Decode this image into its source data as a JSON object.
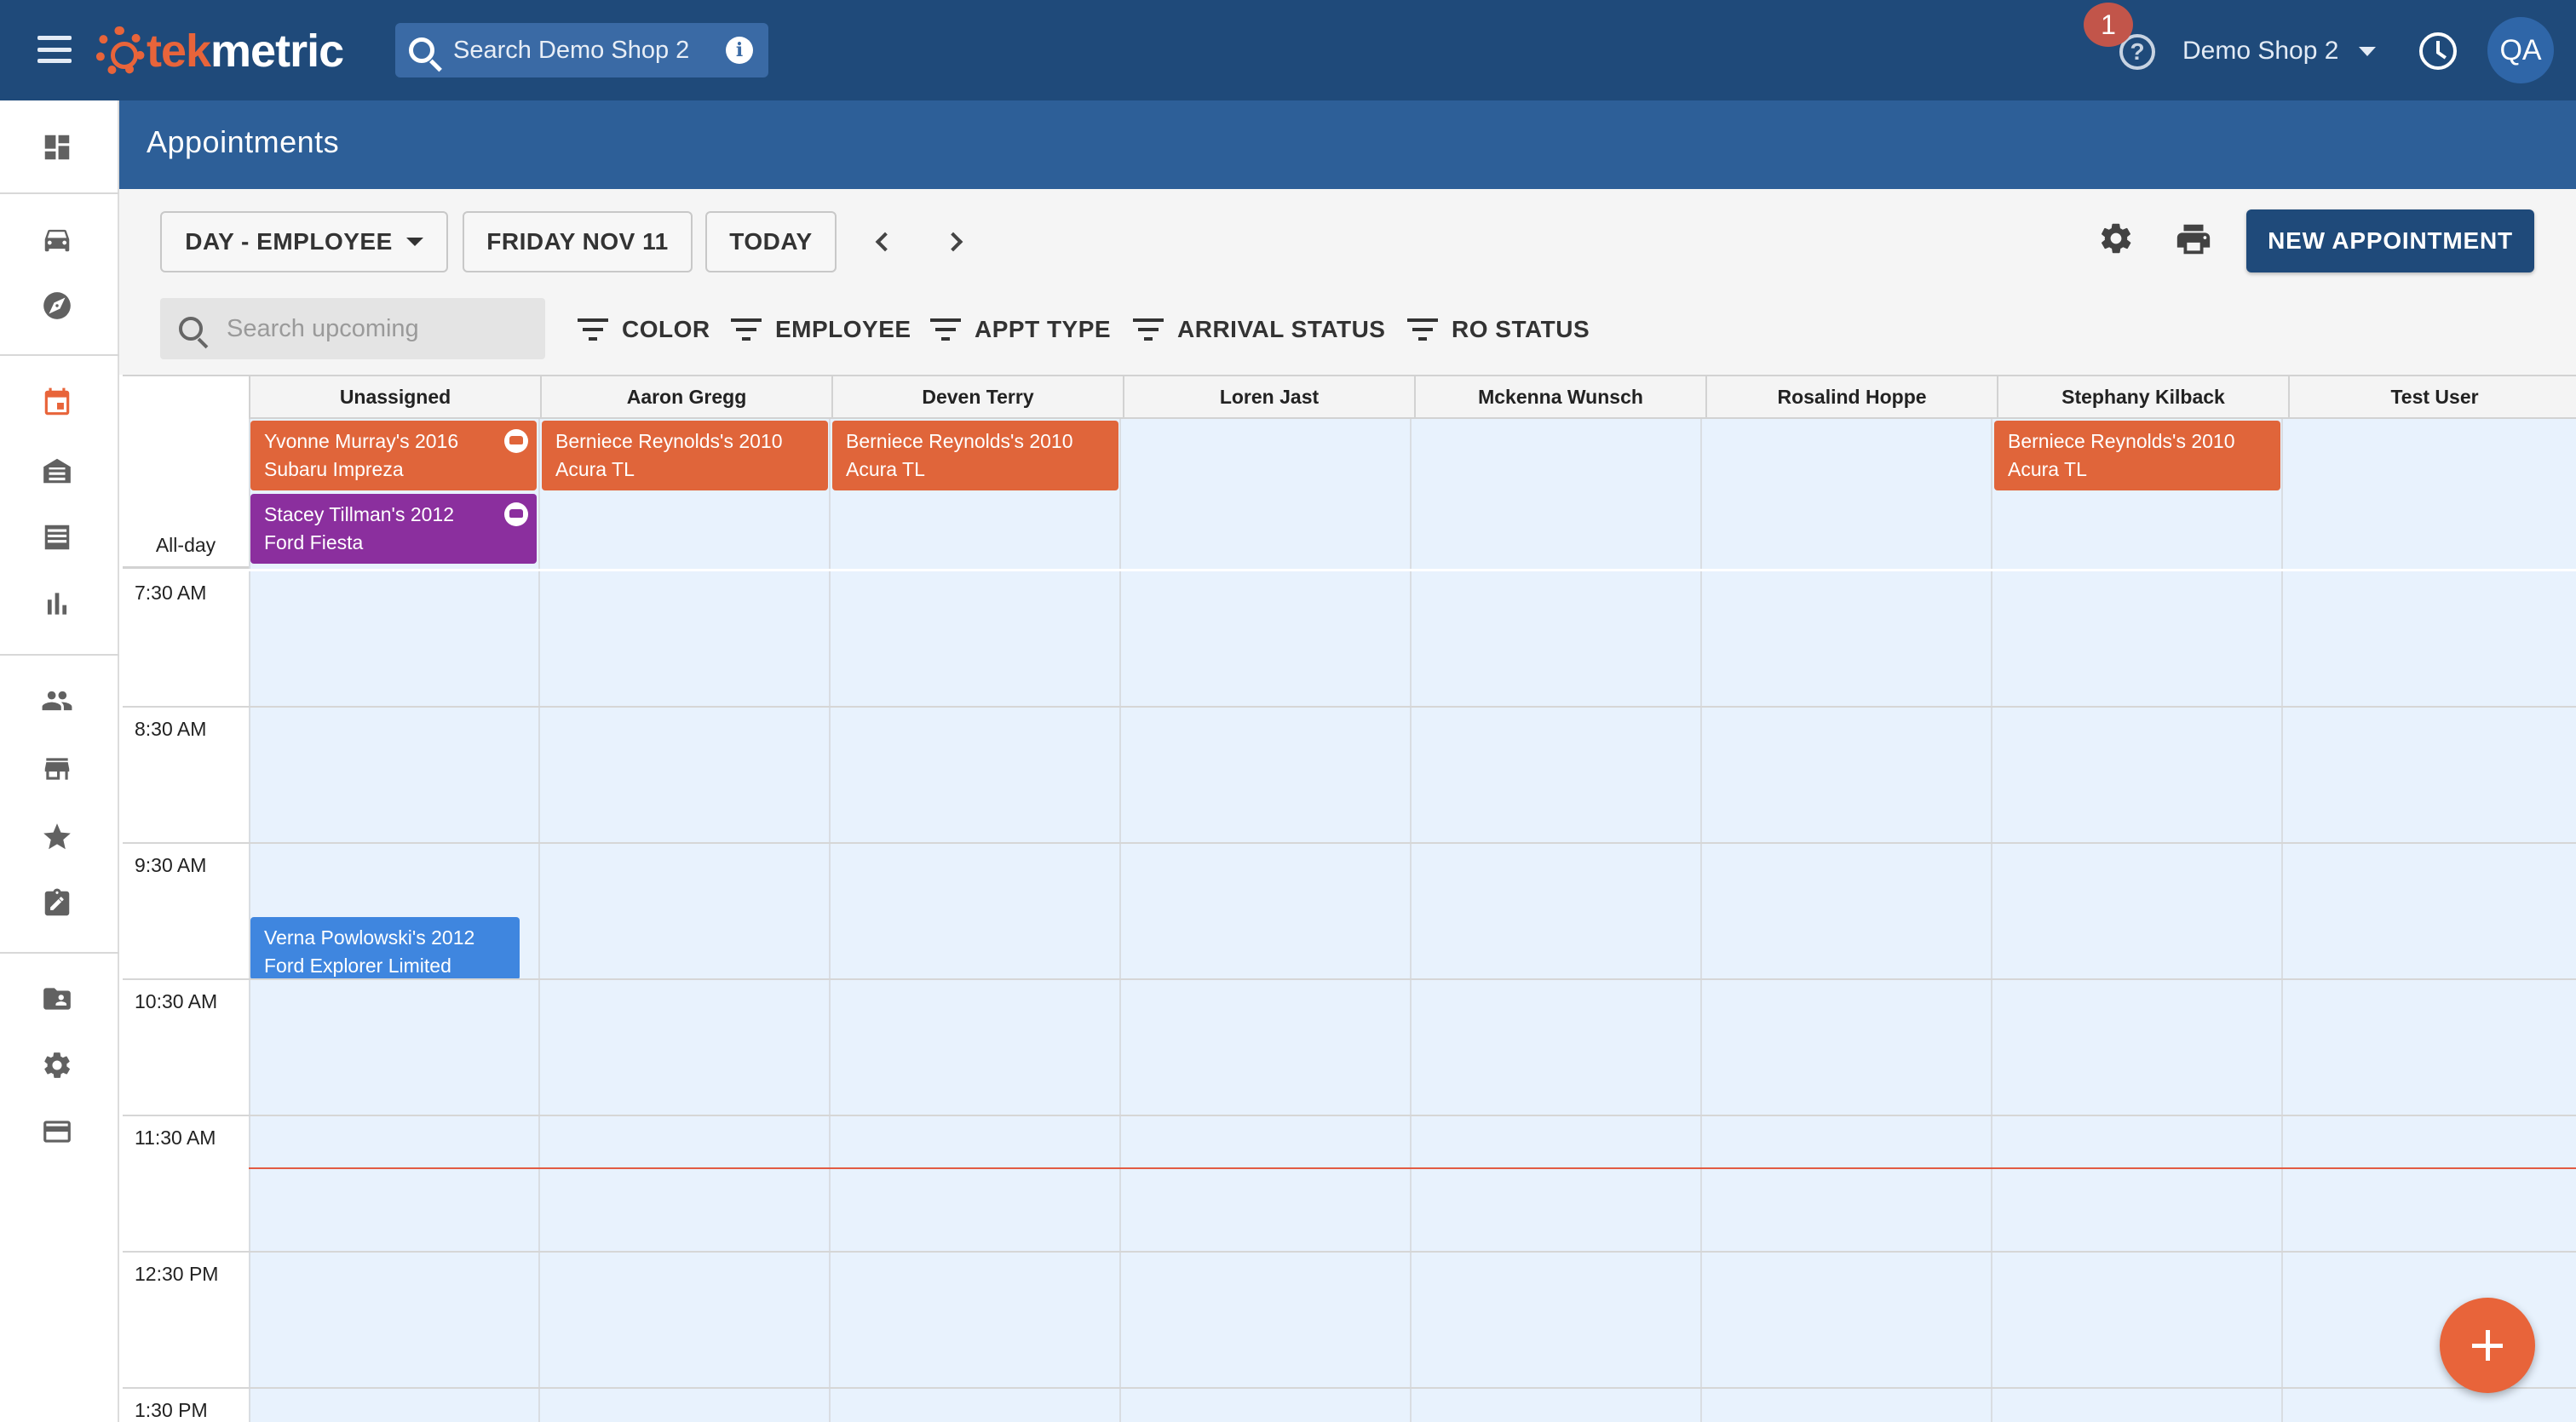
{
  "header": {
    "logo_tek": "tek",
    "logo_metric": "metric",
    "search_placeholder": "Search Demo Shop 2",
    "notification_count": "1",
    "help_glyph": "?",
    "shop_name": "Demo Shop 2",
    "avatar_initials": "QA"
  },
  "page": {
    "title": "Appointments"
  },
  "toolbar": {
    "view_label": "DAY - EMPLOYEE",
    "date_label": "FRIDAY NOV 11",
    "today_label": "TODAY",
    "new_appointment_label": "NEW APPOINTMENT",
    "search_upcoming_placeholder": "Search upcoming",
    "filters": [
      "COLOR",
      "EMPLOYEE",
      "APPT TYPE",
      "ARRIVAL STATUS",
      "RO STATUS"
    ]
  },
  "calendar": {
    "columns": [
      "Unassigned",
      "Aaron Gregg",
      "Deven Terry",
      "Loren Jast",
      "Mckenna Wunsch",
      "Rosalind Hoppe",
      "Stephany Kilback",
      "Test User"
    ],
    "allday_label": "All-day",
    "times": [
      "7:30 AM",
      "8:30 AM",
      "9:30 AM",
      "10:30 AM",
      "11:30 AM",
      "12:30 PM",
      "1:30 PM"
    ],
    "allday_events": [
      {
        "line1": "Yvonne Murray's 2016",
        "line2": "Subaru Impreza",
        "color": "#e0653a"
      },
      {
        "line1": "Stacey Tillman's 2012",
        "line2": "Ford Fiesta",
        "color": "#8b2f9e"
      },
      {
        "line1": "Berniece Reynolds's 2010",
        "line2": "Acura TL",
        "color": "#e0653a"
      },
      {
        "line1": "Berniece Reynolds's 2010",
        "line2": "Acura TL",
        "color": "#e0653a"
      },
      {
        "line1": "Berniece Reynolds's 2010",
        "line2": "Acura TL",
        "color": "#e0653a"
      }
    ],
    "timed_events": [
      {
        "line1": "Verna Powlowski's 2012",
        "line2": "Ford Explorer Limited",
        "color": "#3f86df"
      }
    ]
  },
  "icons": {
    "menu": "hamburger-icon",
    "search": "search-icon",
    "info": "info-icon",
    "help": "help-icon",
    "history": "clock-icon",
    "settings": "gear-icon",
    "print": "printer-icon",
    "add": "plus-icon",
    "car_badge": "car-icon"
  },
  "colors": {
    "brand_dark": "#1f4a7a",
    "brand_mid": "#2d5f98",
    "accent_orange": "#e8643a",
    "event_orange": "#e0653a",
    "event_purple": "#8b2f9e",
    "event_blue": "#3f86df",
    "calendar_bg": "#e8f2fd",
    "now_line": "#e25b43"
  }
}
